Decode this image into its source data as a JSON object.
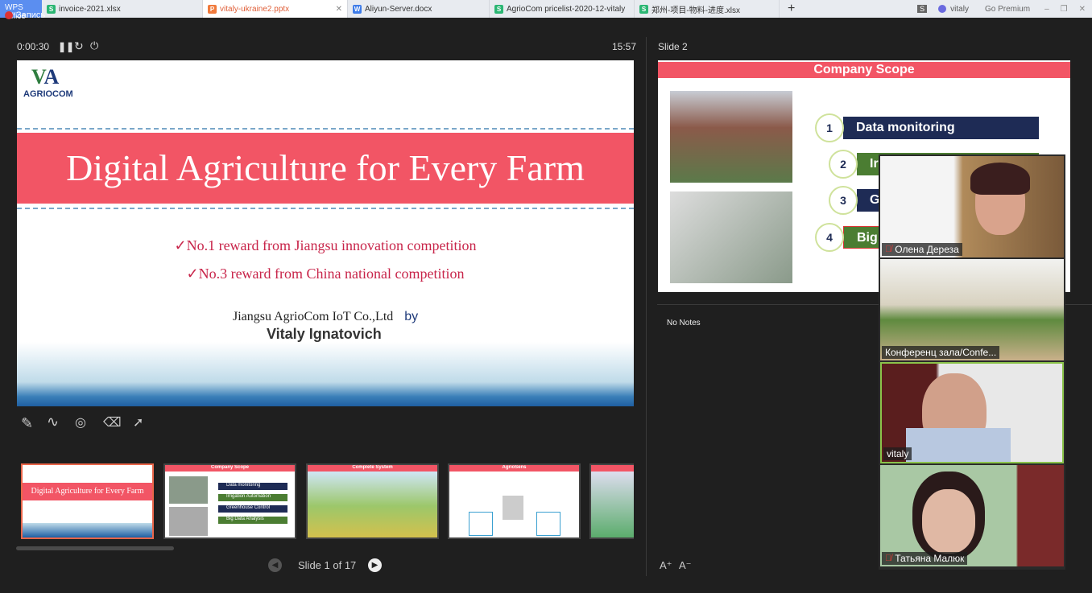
{
  "tabbar": {
    "app": "WPS Office",
    "tabs": [
      {
        "label": "invoice-2021.xlsx",
        "icon": "S",
        "color": "#2bb673"
      },
      {
        "label": "vitaly-ukraine2.pptx",
        "icon": "P",
        "color": "#f07a3c",
        "active": true
      },
      {
        "label": "Aliyun-Server.docx",
        "icon": "W",
        "color": "#3d7be8"
      },
      {
        "label": "AgrioCom pricelist-2020-12-vitaly",
        "icon": "S",
        "color": "#2bb673"
      },
      {
        "label": "郑州-项目-物料-进度.xlsx",
        "icon": "S",
        "color": "#2bb673"
      }
    ],
    "new_tab": "+",
    "account_badge": "S",
    "user": "vitaly",
    "premium": "Go Premium"
  },
  "recording": {
    "label": "Запись"
  },
  "presenter": {
    "elapsed": "0:00:30",
    "clock": "15:57",
    "next_label": "Slide 2",
    "notes": "No Notes",
    "font_up": "A⁺",
    "font_down": "A⁻"
  },
  "slide1": {
    "logo": "AGRIOCOM",
    "title": "Digital Agriculture for Every Farm",
    "bullets": [
      "No.1 reward from Jiangsu innovation competition",
      "No.3 reward from China national competition"
    ],
    "company": "Jiangsu AgrioCom IoT Co.,Ltd",
    "by": "by",
    "author": "Vitaly Ignatovich"
  },
  "slide2": {
    "title": "Company Scope",
    "items": [
      {
        "n": "1",
        "label": "Data monitoring"
      },
      {
        "n": "2",
        "label": "Irrigation Automation"
      },
      {
        "n": "3",
        "label": "Greenhouse Control"
      },
      {
        "n": "4",
        "label": "Big Data Analysis"
      }
    ]
  },
  "thumbs": {
    "t3": "Complete System",
    "t4": "AgrioSens"
  },
  "nav": {
    "status": "Slide 1 of 17"
  },
  "participants": [
    {
      "name": "Олена Дереза",
      "muted": true
    },
    {
      "name": "Конференц зала/Confe...",
      "muted": false
    },
    {
      "name": "vitaly",
      "muted": false,
      "speaking": true
    },
    {
      "name": "Татьяна Малюк",
      "muted": true
    }
  ]
}
